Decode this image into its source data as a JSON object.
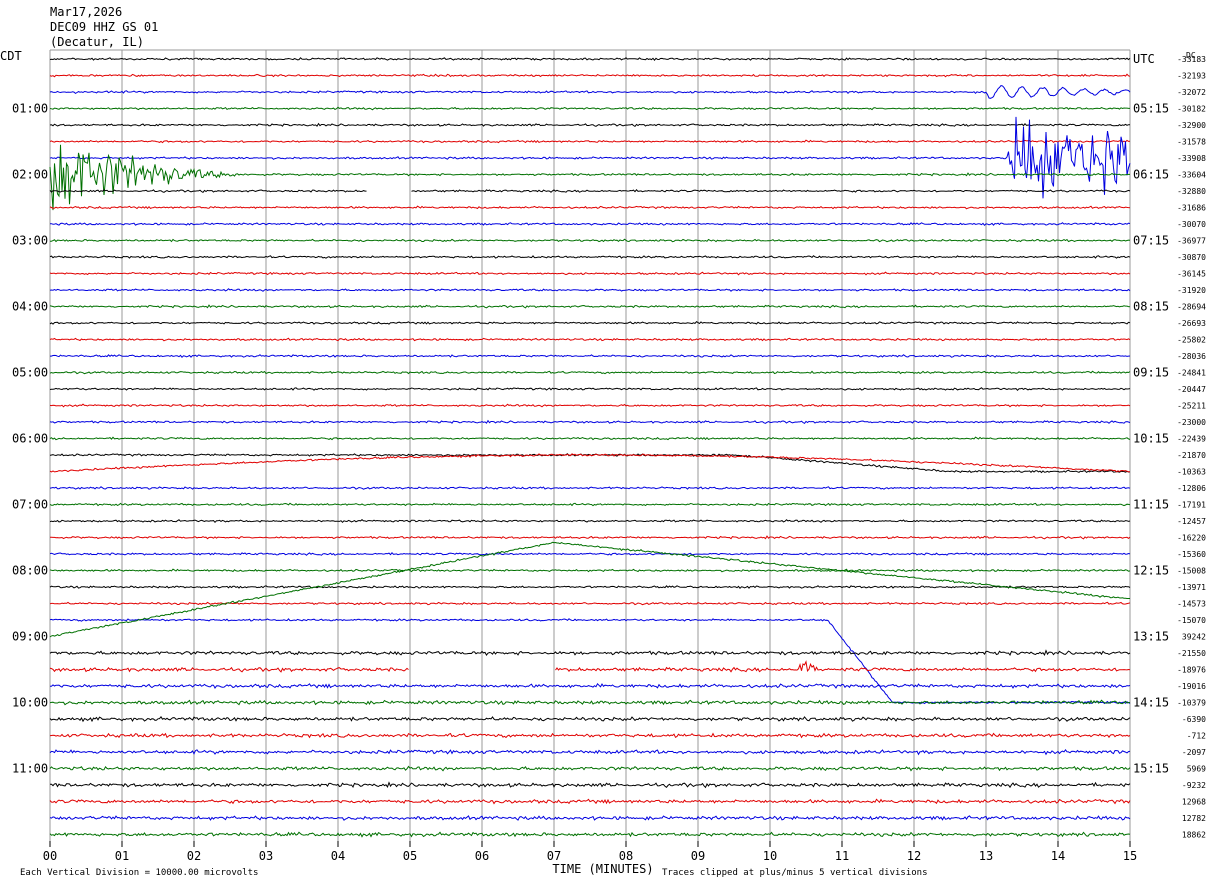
{
  "header": {
    "date": "Mar17,2026",
    "station": "DEC09 HHZ GS 01",
    "location": "(Decatur, IL)"
  },
  "footer": {
    "xlabel": "TIME (MINUTES)",
    "scale_note": "Each Vertical Division = 10000.00 microvolts",
    "clip_note": "Traces clipped at plus/minus 5 vertical divisions"
  },
  "colors": {
    "trace_cycle": [
      "#000000",
      "#e00000",
      "#0000e0",
      "#007000"
    ],
    "grid": "#999999",
    "text": "#000000"
  },
  "chart_data": {
    "type": "line",
    "subtype": "helicorder",
    "left_axis_title": "CDT",
    "right_axis_title": "UTC",
    "corner_label": "DC",
    "x_ticks": [
      "00",
      "01",
      "02",
      "03",
      "04",
      "05",
      "06",
      "07",
      "08",
      "09",
      "10",
      "11",
      "12",
      "13",
      "14",
      "15"
    ],
    "xlim": [
      0,
      15
    ],
    "rows_per_hour": 4,
    "first_row_time_cdt": "00:15",
    "num_rows": 48,
    "left_hour_labels": [
      {
        "row": 3,
        "text": "01:00"
      },
      {
        "row": 7,
        "text": "02:00"
      },
      {
        "row": 11,
        "text": "03:00"
      },
      {
        "row": 15,
        "text": "04:00"
      },
      {
        "row": 19,
        "text": "05:00"
      },
      {
        "row": 23,
        "text": "06:00"
      },
      {
        "row": 27,
        "text": "07:00"
      },
      {
        "row": 31,
        "text": "08:00"
      },
      {
        "row": 35,
        "text": "09:00"
      },
      {
        "row": 39,
        "text": "10:00"
      },
      {
        "row": 43,
        "text": "11:00"
      }
    ],
    "right_hour_labels": [
      {
        "row": 0,
        "text": "UTC"
      },
      {
        "row": 3,
        "text": "05:15"
      },
      {
        "row": 7,
        "text": "06:15"
      },
      {
        "row": 11,
        "text": "07:15"
      },
      {
        "row": 15,
        "text": "08:15"
      },
      {
        "row": 19,
        "text": "09:15"
      },
      {
        "row": 23,
        "text": "10:15"
      },
      {
        "row": 27,
        "text": "11:15"
      },
      {
        "row": 31,
        "text": "12:15"
      },
      {
        "row": 35,
        "text": "13:15"
      },
      {
        "row": 39,
        "text": "14:15"
      },
      {
        "row": 43,
        "text": "15:15"
      }
    ],
    "dc_offsets": [
      "-33183",
      "-32193",
      "-32072",
      "-30182",
      "-32900",
      "-31578",
      "-33908",
      "-33604",
      "-32880",
      "-31686",
      "-30070",
      "-36977",
      "-30870",
      "-36145",
      "-31920",
      "-28694",
      "-26693",
      "-25802",
      "-28036",
      "-24841",
      "-20447",
      "-25211",
      "-23000",
      "-22439",
      "-21870",
      "-10363",
      "-12806",
      "-17191",
      "-12457",
      "-16220",
      "-15360",
      "-15008",
      "-13971",
      "-14573",
      "-15070",
      "39242",
      "-21550",
      "-18976",
      "-19016",
      "-10379",
      "-6390",
      "-712",
      "-2097",
      "5969",
      "-9232",
      "12968",
      "12782",
      "18862"
    ],
    "events": [
      {
        "row": 2,
        "type": "wavetrain",
        "x_start": 13.0,
        "x_end": 15.0,
        "amplitude_div": 0.4
      },
      {
        "row": 6,
        "type": "burst",
        "x_start": 13.3,
        "x_end": 15.0,
        "amplitude_div": 2.5
      },
      {
        "row": 7,
        "type": "decay",
        "x_start": 0.0,
        "x_end": 3.0,
        "amplitude_div": 2.5
      },
      {
        "row": 8,
        "type": "gap",
        "x_start": 4.4,
        "x_end": 5.0
      },
      {
        "row": 25,
        "type": "drift",
        "x_start": 0.0,
        "x_end": 15.0
      },
      {
        "row": 24,
        "type": "drift",
        "x_start": 9.5,
        "x_end": 12.5
      },
      {
        "row": 35,
        "type": "ramp",
        "x_start": 0.0,
        "x_end": 7.0
      },
      {
        "row": 34,
        "type": "step",
        "x_start": 10.8,
        "x_end": 11.7
      },
      {
        "row": 37,
        "type": "gap",
        "x_start": 5.0,
        "x_end": 7.0
      },
      {
        "row": 37,
        "type": "spike",
        "x": 10.5,
        "amplitude_div": 1.0
      }
    ]
  }
}
